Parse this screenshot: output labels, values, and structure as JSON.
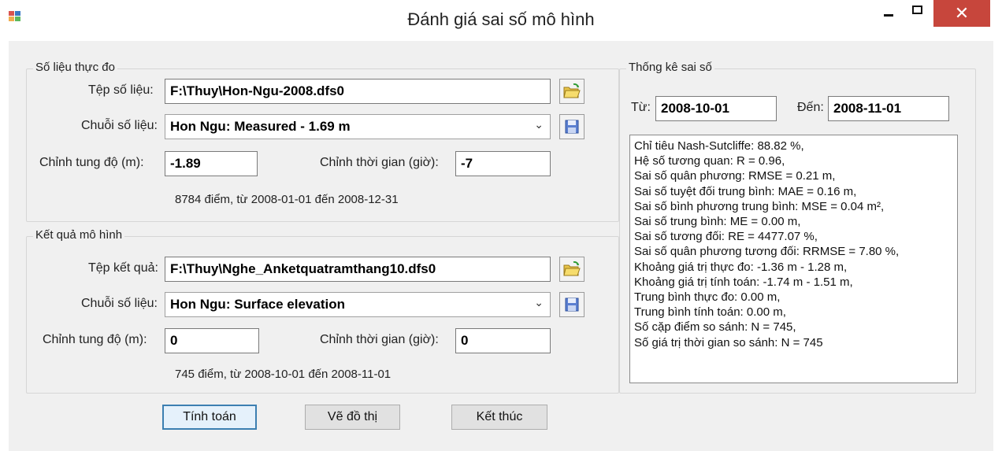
{
  "window": {
    "title": "Đánh giá sai số mô hình"
  },
  "measured": {
    "group_title": "Số liệu thực đo",
    "file_label": "Tệp số liệu:",
    "file_value": "F:\\Thuy\\Hon-Ngu-2008.dfs0",
    "series_label": "Chuỗi số liệu:",
    "series_value": "Hon Ngu: Measured - 1.69 m",
    "level_label": "Chỉnh tung độ (m):",
    "level_value": "-1.89",
    "time_label": "Chỉnh thời gian (giờ):",
    "time_value": "-7",
    "summary": "8784 điểm, từ 2008-01-01 đến 2008-12-31"
  },
  "model": {
    "group_title": "Kết quả mô hình",
    "file_label": "Tệp kết quả:",
    "file_value": "F:\\Thuy\\Nghe_Anketquatramthang10.dfs0",
    "series_label": "Chuỗi số liệu:",
    "series_value": "Hon Ngu: Surface elevation",
    "level_label": "Chỉnh tung độ (m):",
    "level_value": "0",
    "time_label": "Chỉnh thời gian (giờ):",
    "time_value": "0",
    "summary": "745 điểm, từ 2008-10-01 đến 2008-11-01"
  },
  "buttons": {
    "compute": "Tính toán",
    "plot": "Vẽ đồ thị",
    "exit": "Kết thúc"
  },
  "stats": {
    "group_title": "Thống kê sai số",
    "from_label": "Từ:",
    "from_value": "2008-10-01",
    "to_label": "Đến:",
    "to_value": "2008-11-01",
    "lines": [
      "Chỉ tiêu Nash-Sutcliffe: 88.82 %,",
      "Hệ số tương quan: R = 0.96,",
      "Sai số quân phương: RMSE = 0.21 m,",
      "Sai số tuyệt đối trung bình: MAE = 0.16 m,",
      "Sai số bình phương trung bình: MSE = 0.04 m²,",
      "Sai số trung bình: ME = 0.00 m,",
      "Sai số tương đối: RE = 4477.07 %,",
      "Sai số quân phương tương đối: RRMSE = 7.80 %,",
      "Khoảng giá trị thực đo: -1.36 m - 1.28 m,",
      "Khoảng giá trị tính toán: -1.74 m - 1.51 m,",
      "Trung bình thực đo: 0.00 m,",
      "Trung bình tính toán: 0.00 m,",
      "Số cặp điểm so sánh: N = 745,",
      "Số giá trị thời gian so sánh: N = 745"
    ]
  },
  "icons": {
    "app": "app-icon",
    "open": "open-folder-icon",
    "save": "save-floppy-icon",
    "dropdown": "chevron-down-icon"
  },
  "colors": {
    "close_button": "#c7463c",
    "client_bg": "#f0f0f0",
    "default_button_border": "#3c7fb1"
  }
}
